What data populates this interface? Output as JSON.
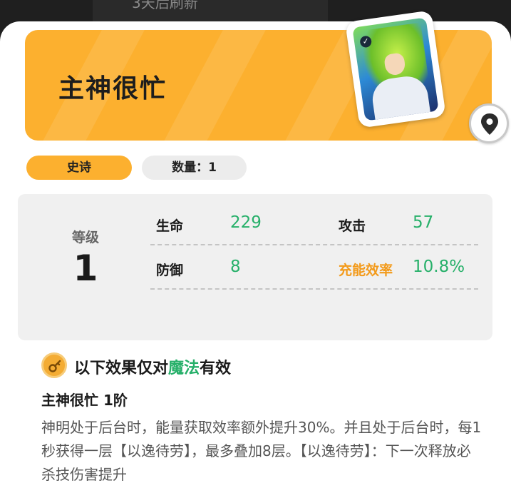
{
  "background": {
    "top_text": "3天后刷新"
  },
  "card": {
    "name": "主神很忙",
    "rarity": "史诗",
    "quantity_label": "数量：1",
    "level_label": "等级",
    "level": "1",
    "stats": {
      "hp_label": "生命",
      "hp": "229",
      "atk_label": "攻击",
      "atk": "57",
      "def_label": "防御",
      "def": "8",
      "charge_label": "充能效率",
      "charge": "10.8%"
    }
  },
  "effect": {
    "condition_prefix": "以下效果仅对",
    "condition_keyword": "魔法",
    "condition_suffix": "有效",
    "skill_title": "主神很忙 1阶",
    "description": "神明处于后台时，能量获取效率额外提升30%。并且处于后台时，每1秒获得一层【以逸待劳】，最多叠加8层。【以逸待劳】：下一次释放必杀技伤害提升"
  },
  "colors": {
    "banner": "#fcb02f",
    "stat_value": "#27b06a",
    "highlight": "#f39a1a"
  },
  "icons": [
    "location-pin-icon",
    "key-icon",
    "check-icon"
  ]
}
